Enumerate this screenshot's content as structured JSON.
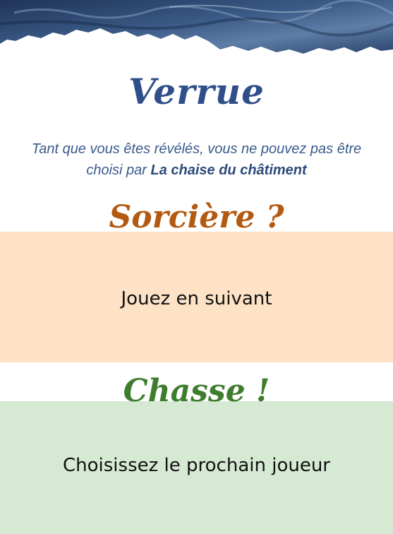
{
  "card": {
    "title": "Verrue",
    "description_text": "Tant que vous êtes révélés, vous ne pouvez pas être choisi par ",
    "description_bold": "La chaise du châtiment",
    "witch": {
      "title": "Sorcière ?",
      "action": "Jouez en suivant"
    },
    "hunt": {
      "title": "Chasse !",
      "action": "Choisissez le prochain joueur"
    }
  },
  "colors": {
    "title_blue": "#2f4f8a",
    "witch_band": "#fde2c6",
    "witch_title": "#b35a12",
    "hunt_band": "#d6ead3",
    "hunt_title": "#3f7d2e",
    "header_art": "#2d4468"
  }
}
